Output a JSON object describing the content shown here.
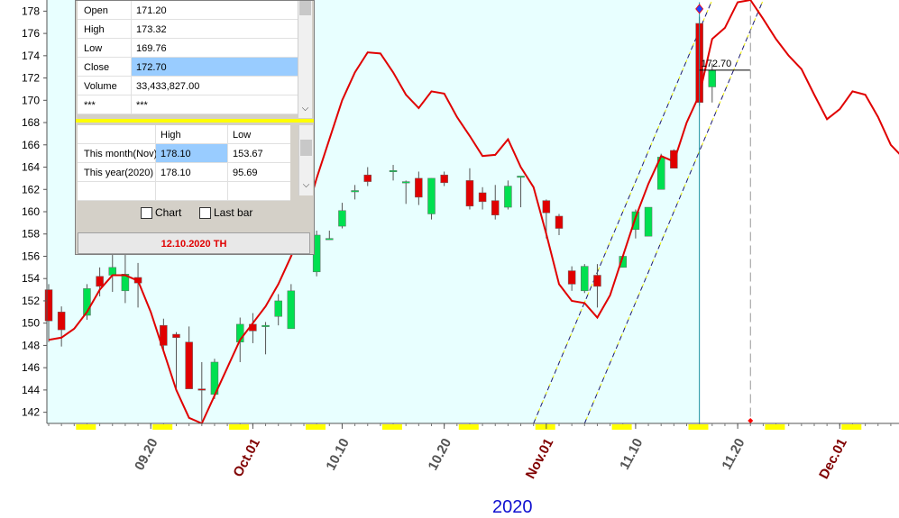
{
  "chart_data": {
    "type": "candlestick",
    "xlabel": "2020",
    "ylim": [
      141,
      179
    ],
    "y_ticks": [
      142,
      144,
      146,
      148,
      150,
      152,
      154,
      156,
      158,
      160,
      162,
      164,
      166,
      168,
      170,
      172,
      174,
      176,
      178
    ],
    "x_ticks": [
      {
        "label": "09.20",
        "index": 8
      },
      {
        "label": "Oct.01",
        "index": 16,
        "highlight": true
      },
      {
        "label": "10.10",
        "index": 23
      },
      {
        "label": "10.20",
        "index": 31
      },
      {
        "label": "Nov.01",
        "index": 39,
        "highlight": true
      },
      {
        "label": "11.10",
        "index": 46
      },
      {
        "label": "11.20",
        "index": 54
      },
      {
        "label": "Dec.01",
        "index": 62,
        "highlight": true
      }
    ],
    "candles": [
      {
        "o": 153,
        "h": 153.5,
        "l": 148.3,
        "c": 150.2
      },
      {
        "o": 151,
        "h": 151.5,
        "l": 147.9,
        "c": 149.4
      },
      null,
      {
        "o": 150.7,
        "h": 153.5,
        "l": 150.3,
        "c": 153.1
      },
      {
        "o": 154.2,
        "h": 155,
        "l": 152.4,
        "c": 153.3
      },
      {
        "o": 154.3,
        "h": 156.2,
        "l": 152.8,
        "c": 155
      },
      {
        "o": 152.9,
        "h": 156.8,
        "l": 151.8,
        "c": 154.4
      },
      {
        "o": 154.1,
        "h": 155.4,
        "l": 151.4,
        "c": 153.6
      },
      null,
      {
        "o": 149.8,
        "h": 150.4,
        "l": 147.6,
        "c": 148
      },
      {
        "o": 149,
        "h": 149.2,
        "l": 144.1,
        "c": 148.7
      },
      {
        "o": 148.3,
        "h": 149.7,
        "l": 144.5,
        "c": 144.1
      },
      {
        "o": 144.1,
        "h": 146.5,
        "l": 141.2,
        "c": 144
      },
      {
        "o": 143.6,
        "h": 146.8,
        "l": 143.2,
        "c": 146.5
      },
      null,
      {
        "o": 148.3,
        "h": 150.5,
        "l": 146.5,
        "c": 149.9
      },
      {
        "o": 149.9,
        "h": 150.9,
        "l": 148.2,
        "c": 149.3
      },
      {
        "o": 149.8,
        "h": 150.1,
        "l": 147.2,
        "c": 149.8
      },
      {
        "o": 150.6,
        "h": 152.6,
        "l": 149.8,
        "c": 152
      },
      {
        "o": 149.5,
        "h": 153.5,
        "l": 149.5,
        "c": 152.9
      },
      null,
      {
        "o": 154.6,
        "h": 158.3,
        "l": 154.2,
        "c": 157.9
      },
      {
        "o": 157.6,
        "h": 158.3,
        "l": 157.5,
        "c": 157.6
      },
      {
        "o": 158.7,
        "h": 160.8,
        "l": 158.5,
        "c": 160.1
      },
      {
        "o": 161.9,
        "h": 162.4,
        "l": 161.1,
        "c": 161.9
      },
      {
        "o": 163.3,
        "h": 164,
        "l": 162.3,
        "c": 162.7
      },
      null,
      {
        "o": 163.6,
        "h": 164.2,
        "l": 162.8,
        "c": 163.7
      },
      {
        "o": 162.7,
        "h": 162.8,
        "l": 160.7,
        "c": 162.7
      },
      {
        "o": 163,
        "h": 163.6,
        "l": 160.6,
        "c": 161.3
      },
      {
        "o": 159.8,
        "h": 163,
        "l": 159.3,
        "c": 163
      },
      {
        "o": 163.3,
        "h": 163.6,
        "l": 162.3,
        "c": 162.6
      },
      null,
      {
        "o": 162.8,
        "h": 163.9,
        "l": 160.2,
        "c": 160.5
      },
      {
        "o": 161.7,
        "h": 162.2,
        "l": 160.2,
        "c": 160.9
      },
      {
        "o": 161,
        "h": 162.4,
        "l": 159.3,
        "c": 159.7
      },
      {
        "o": 160.4,
        "h": 162.8,
        "l": 160.2,
        "c": 162.3
      },
      {
        "o": 163.2,
        "h": 163.2,
        "l": 160.4,
        "c": 163.2
      },
      null,
      {
        "o": 161,
        "h": 161.1,
        "l": 157.6,
        "c": 159.9
      },
      {
        "o": 159.6,
        "h": 159.8,
        "l": 157.9,
        "c": 158.5
      },
      {
        "o": 154.7,
        "h": 155.1,
        "l": 152.9,
        "c": 153.5
      },
      {
        "o": 152.9,
        "h": 155.3,
        "l": 152.7,
        "c": 155.1
      },
      {
        "o": 154.3,
        "h": 155.3,
        "l": 151.4,
        "c": 153.3
      },
      null,
      {
        "o": 155,
        "h": 156,
        "l": 155,
        "c": 156
      },
      {
        "o": 158.4,
        "h": 160.2,
        "l": 157.6,
        "c": 160
      },
      {
        "o": 157.8,
        "h": 160.4,
        "l": 157.8,
        "c": 160.4
      },
      {
        "o": 162,
        "h": 165.2,
        "l": 162,
        "c": 164.9
      },
      {
        "o": 165.5,
        "h": 165.6,
        "l": 163.9,
        "c": 163.9
      },
      null,
      {
        "o": 176.9,
        "h": 177.5,
        "l": 169.5,
        "c": 169.8
      },
      {
        "o": 171.2,
        "h": 173.3,
        "l": 169.8,
        "c": 172.7
      }
    ],
    "ma_line": [
      148.5,
      148.7,
      149.5,
      151,
      153,
      154.3,
      154.3,
      153.8,
      151,
      147.5,
      144,
      141.5,
      141,
      143.5,
      146,
      148.5,
      150,
      151.5,
      153.5,
      156,
      159,
      163,
      166.5,
      170,
      172.5,
      174.3,
      174.2,
      172.5,
      170.5,
      169.3,
      170.8,
      170.6,
      168.5,
      166.8,
      165,
      165.1,
      166.5,
      164,
      162.2,
      158,
      153.5,
      152,
      151.8,
      150.5,
      152.5,
      156,
      159.5,
      162.5,
      165,
      164.5,
      168,
      170.5,
      175.5,
      176.5,
      178.8,
      179,
      177.3,
      175.5,
      174,
      172.8,
      170.5,
      168.3,
      169.2,
      170.8,
      170.5,
      168.5,
      166,
      164.8
    ],
    "future_start_index": 55,
    "channel_lines": [
      {
        "x1": 38,
        "y1": 141,
        "x2": 52,
        "y2": 179
      },
      {
        "x1": 42,
        "y1": 141,
        "x2": 56,
        "y2": 179
      }
    ],
    "crosshair_value": "172.70",
    "crosshair_index": 51,
    "marker_index": 55,
    "colors": {
      "up": "#00e050",
      "down": "#e00000",
      "ma": "#e00000",
      "plot_bg": "#e8ffff",
      "highlight_tick": "#800000",
      "tick": "#555555"
    }
  },
  "info_panel": {
    "ohlc": [
      {
        "label": "Open",
        "value": "171.20"
      },
      {
        "label": "High",
        "value": "173.32"
      },
      {
        "label": "Low",
        "value": "169.76"
      },
      {
        "label": "Close",
        "value": "172.70"
      },
      {
        "label": "Volume",
        "value": "33,433,827.00"
      },
      {
        "label": "***",
        "value": "***"
      }
    ],
    "range_header": [
      "",
      "High",
      "Low"
    ],
    "ranges": [
      {
        "label": "This month(Nov)",
        "high": "178.10",
        "low": "153.67"
      },
      {
        "label": "This year(2020)",
        "high": "178.10",
        "low": "95.69"
      }
    ],
    "chart_checkbox_label": "Chart",
    "lastbar_checkbox_label": "Last bar",
    "date_label": "12.10.2020 TH"
  }
}
